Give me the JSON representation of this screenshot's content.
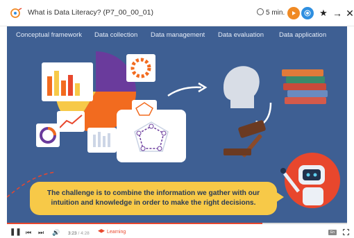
{
  "window": {
    "title": "What is Data Literacy? (P7_00_00_01)",
    "duration": "5 min."
  },
  "tabs": [
    {
      "label": "Conceptual framework"
    },
    {
      "label": "Data collection"
    },
    {
      "label": "Data management"
    },
    {
      "label": "Data evaluation"
    },
    {
      "label": "Data application"
    }
  ],
  "caption": {
    "line1": "The challenge is to combine the information we gather with our",
    "line2": "intuition and knowledge in order to make the right decisions."
  },
  "player": {
    "time_current": "3:23",
    "time_total": "/ 4:28",
    "mode": "Learning",
    "progress": 0.75,
    "cc_label": "En"
  },
  "icons": [
    "logo-icon",
    "clock-icon",
    "play-icon",
    "share-icon",
    "star-icon",
    "next-icon",
    "close-icon",
    "pause-icon",
    "prev-icon",
    "skip-icon",
    "volume-icon",
    "mortarboard-icon",
    "fullscreen-icon"
  ],
  "colors": {
    "stage": "#3e5f93",
    "caption": "#f7c948",
    "accent": "#e8472d",
    "orange": "#f08a24"
  }
}
